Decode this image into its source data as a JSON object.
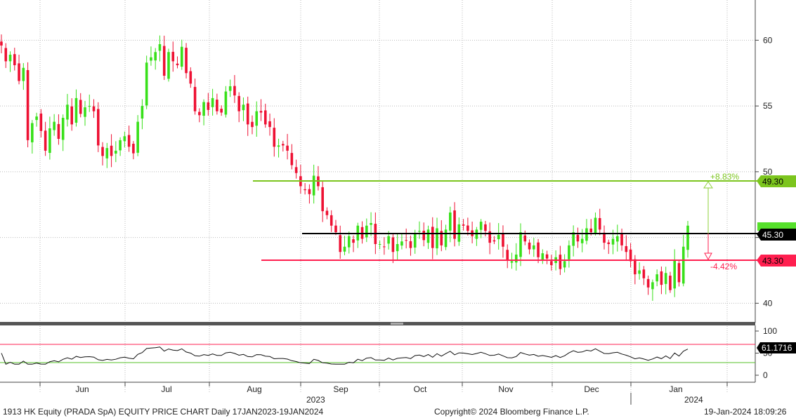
{
  "chart_data": {
    "type": "candlestick",
    "price_axis": {
      "ylim": [
        38,
        63
      ],
      "ticks": [
        "40",
        "45",
        "50",
        "55",
        "60"
      ]
    },
    "rsi_axis": {
      "ylim": [
        -5,
        105
      ],
      "ticks": [
        "0",
        "50",
        "100"
      ],
      "upper_band": 70,
      "lower_band": 30,
      "current_label": "61.1716"
    },
    "months": [
      "Jun",
      "Jul",
      "Aug",
      "Sep",
      "Oct",
      "Nov",
      "Dec",
      "Jan"
    ],
    "years": [
      "2023",
      "2024"
    ],
    "levels": [
      {
        "value": 49.3,
        "label": "49.30",
        "color": "#7cc51e"
      },
      {
        "value": 45.3,
        "label": "45.30",
        "color": "#000000"
      },
      {
        "value": 43.3,
        "label": "43.30",
        "color": "#ff1f4f"
      }
    ],
    "annotations": {
      "up_pct": "+8.83%",
      "down_pct": "-4.42%"
    },
    "closes": [
      59.6,
      58.4,
      58.9,
      58.1,
      56.9,
      57.9,
      52.4,
      53.7,
      54.2,
      53.1,
      51.6,
      53.3,
      53.8,
      52.5,
      54.1,
      55.1,
      53.6,
      55.6,
      54.4,
      54.9,
      55.0,
      54.6,
      52.0,
      51.2,
      51.8,
      51.2,
      51.6,
      52.4,
      52.7,
      51.9,
      51.4,
      53.8,
      55.0,
      58.3,
      58.7,
      59.1,
      59.7,
      57.3,
      59.1,
      58.4,
      58.1,
      59.5,
      57.5,
      56.7,
      54.6,
      54.3,
      55.3,
      54.7,
      55.6,
      54.6,
      54.5,
      56.1,
      56.5,
      55.8,
      54.6,
      55.1,
      53.6,
      53.4,
      54.6,
      54.5,
      53.6,
      53.4,
      51.9,
      52.0,
      52.0,
      51.6,
      50.5,
      49.9,
      48.9,
      48.6,
      48.3,
      49.7,
      48.9,
      47.0,
      46.7,
      45.9,
      45.4,
      43.9,
      44.3,
      45.1,
      44.6,
      45.9,
      44.9,
      45.9,
      46.1,
      44.5,
      44.5,
      44.3,
      45.1,
      43.9,
      44.5,
      44.7,
      44.8,
      44.2,
      45.3,
      45.5,
      44.8,
      45.6,
      44.2,
      45.7,
      44.4,
      45.6,
      46.9,
      44.9,
      46.0,
      45.9,
      45.5,
      45.1,
      45.6,
      46.2,
      45.5,
      44.6,
      44.7,
      45.2,
      44.3,
      43.3,
      43.2,
      43.7,
      45.4,
      44.7,
      44.1,
      44.4,
      43.5,
      43.8,
      43.4,
      42.9,
      43.5,
      42.6,
      43.2,
      44.4,
      45.4,
      44.7,
      44.9,
      45.7,
      45.4,
      46.5,
      45.6,
      44.6,
      44.5,
      44.9,
      45.1,
      44.4,
      43.9,
      43.2,
      42.2,
      42.5,
      41.9,
      41.2,
      41.6,
      42.2,
      41.4,
      42.3,
      41.0,
      43.3,
      41.6,
      44.3,
      45.9
    ]
  },
  "footer": {
    "left": "1913 HK Equity (PRADA SpA) EQUITY PRICE CHART  Daily 17JAN2023-19JAN2024",
    "center": "Copyright© 2024 Bloomberg Finance L.P.",
    "right": "19-Jan-2024 18:09:26"
  }
}
